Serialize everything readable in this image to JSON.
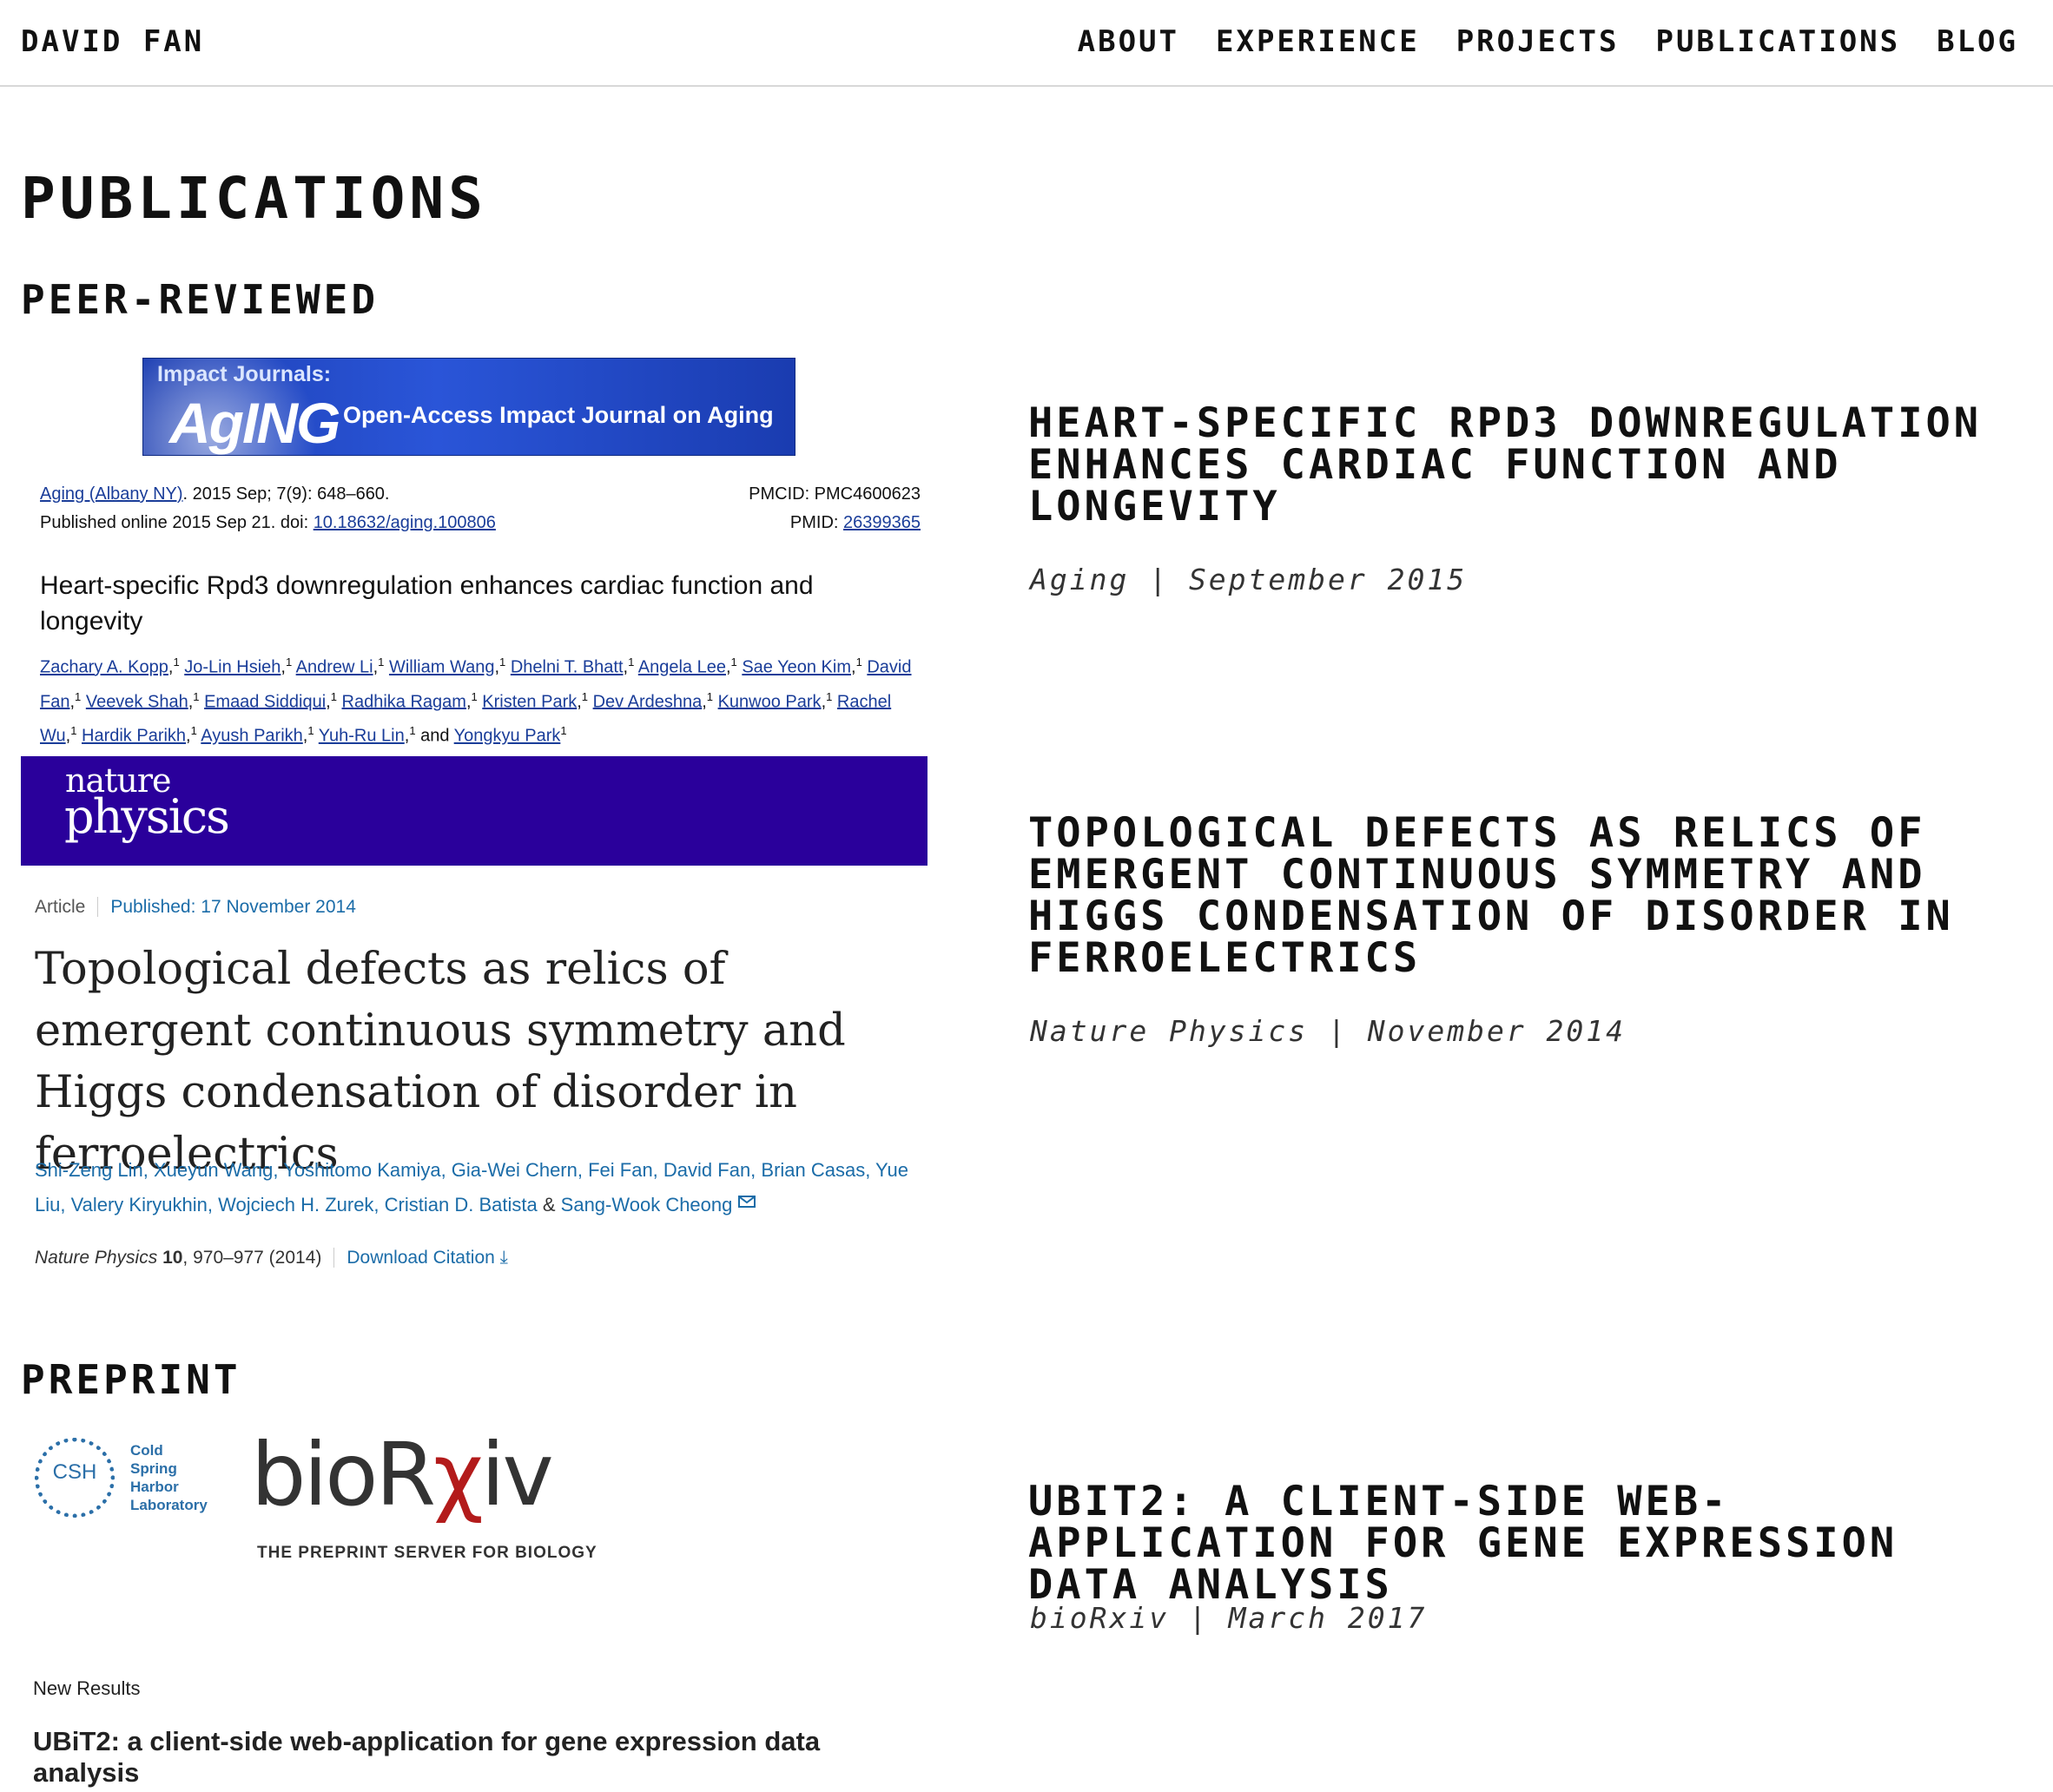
{
  "header": {
    "brand": "DAVID FAN",
    "nav": [
      "ABOUT",
      "EXPERIENCE",
      "PROJECTS",
      "PUBLICATIONS",
      "BLOG"
    ]
  },
  "page_title": "PUBLICATIONS",
  "sections": {
    "peer_reviewed": "PEER-REVIEWED",
    "preprint": "PREPRINT"
  },
  "publications": [
    {
      "title": "HEART-SPECIFIC RPD3 DOWNREGULATION ENHANCES CARDIAC FUNCTION AND LONGEVITY",
      "meta": "Aging | September 2015",
      "thumb": {
        "banner_top": "Impact Journals:",
        "banner_logo": "AgING",
        "banner_tag": "Open-Access Impact Journal on Aging",
        "journal_link": "Aging (Albany NY)",
        "journal_rest": ". 2015 Sep; 7(9): 648–660.",
        "pmcid": "PMCID: PMC4600623",
        "published_prefix": "Published online 2015 Sep 21. doi: ",
        "doi": "10.18632/aging.100806",
        "pmid_label": "PMID: ",
        "pmid": "26399365",
        "title": "Heart-specific Rpd3 downregulation enhances cardiac function and longevity",
        "authors": [
          "Zachary A. Kopp",
          "Jo-Lin Hsieh",
          "Andrew Li",
          "William Wang",
          "Dhelni T. Bhatt",
          "Angela Lee",
          "Sae Yeon Kim",
          "David Fan",
          "Veevek Shah",
          "Emaad Siddiqui",
          "Radhika Ragam",
          "Kristen Park",
          "Dev Ardeshna",
          "Kunwoo Park",
          "Rachel Wu",
          "Hardik Parikh",
          "Ayush Parikh",
          "Yuh-Ru Lin",
          "Yongkyu Park"
        ],
        "affil": "1",
        "and_word": "and"
      }
    },
    {
      "title": "TOPOLOGICAL DEFECTS AS RELICS OF EMERGENT CONTINUOUS SYMMETRY AND HIGGS CONDENSATION OF DISORDER IN FERROELECTRICS",
      "meta": "Nature Physics | November 2014",
      "thumb": {
        "logo_top": "nature",
        "logo_bottom": "physics",
        "article": "Article",
        "published": "Published: 17 November 2014",
        "title": "Topological defects as relics of emergent continuous symmetry and Higgs condensation of disorder in ferroelectrics",
        "authors_line": "Shi-Zeng Lin, Xueyun Wang, Yoshitomo Kamiya, Gia-Wei Chern, Fei Fan, David Fan, Brian Casas, Yue Liu, Valery Kiryukhin, Wojciech H. Zurek, Cristian D. Batista",
        "amp": "&",
        "last_author": "Sang-Wook Cheong",
        "cite_journal": "Nature Physics",
        "cite_volume": "10",
        "cite_rest": ", 970–977 (2014)",
        "download": "Download Citation"
      }
    },
    {
      "title": "UBIT2: A CLIENT-SIDE WEB-APPLICATION FOR GENE EXPRESSION DATA ANALYSIS",
      "meta": "bioRxiv | March 2017",
      "thumb": {
        "csh": "CSH",
        "csh_lab": [
          "Cold",
          "Spring",
          "Harbor",
          "Laboratory"
        ],
        "logo_a": "bioR",
        "logo_b": "χ",
        "logo_c": "iv",
        "tagline": "THE PREPRINT SERVER FOR BIOLOGY",
        "new_results": "New Results",
        "title": "UBiT2: a client-side web-application for gene expression data analysis"
      }
    }
  ]
}
